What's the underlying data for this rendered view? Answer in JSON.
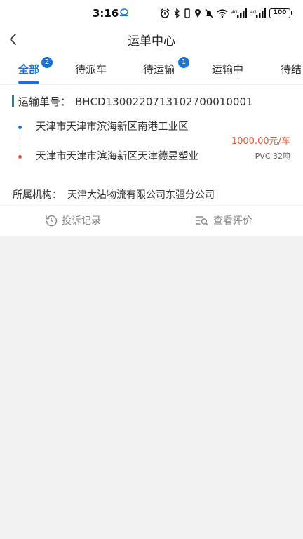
{
  "status_bar": {
    "time": "3:16",
    "battery": "100"
  },
  "navbar": {
    "title": "运单中心"
  },
  "tabs": [
    {
      "label": "全部",
      "badge": "2"
    },
    {
      "label": "待派车"
    },
    {
      "label": "待运输",
      "badge": "1"
    },
    {
      "label": "运输中"
    },
    {
      "label": "待结"
    }
  ],
  "order": {
    "number_label": "运输单号：",
    "number": "BHCD1300220713102700010001",
    "from_address": "天津市天津市滨海新区南港工业区",
    "to_address": "天津市天津市滨海新区天津德昱塑业",
    "price": "1000.00元/车",
    "cargo": "PVC  32吨",
    "org_label": "所属机构：",
    "org": "天津大沽物流有限公司东疆分公司",
    "complaint_label": "投诉记录",
    "review_label": "查看评价"
  },
  "colors": {
    "accent": "#1a74d8",
    "price": "#e05a3a",
    "background": "#f2f2f2"
  }
}
